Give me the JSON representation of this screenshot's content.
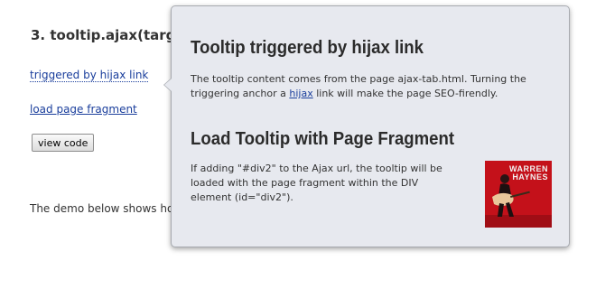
{
  "page": {
    "heading": "3. tooltip.ajax(targe",
    "link_hijax": "triggered by hijax link",
    "link_fragment": "load page fragment",
    "view_code_button": "view code",
    "demo_text": "The demo below shows ho"
  },
  "tooltip": {
    "title1": "Tooltip triggered by hijax link",
    "para1_before": "The tooltip content comes from the page ajax-tab.html. Turning the triggering anchor a ",
    "para1_link": "hijax",
    "para1_after": " link will make the page SEO-firendly.",
    "title2": "Load Tooltip with Page Fragment",
    "para2": "If adding \"#div2\" to the Ajax url, the tooltip will be loaded with the page fragment within the DIV element (id=\"div2\").",
    "album_name_line1": "WARREN",
    "album_name_line2": "HAYNES"
  },
  "colors": {
    "tooltip_bg": "#e7e9ef",
    "link": "#1a3e9c",
    "album_red": "#c4111a"
  }
}
